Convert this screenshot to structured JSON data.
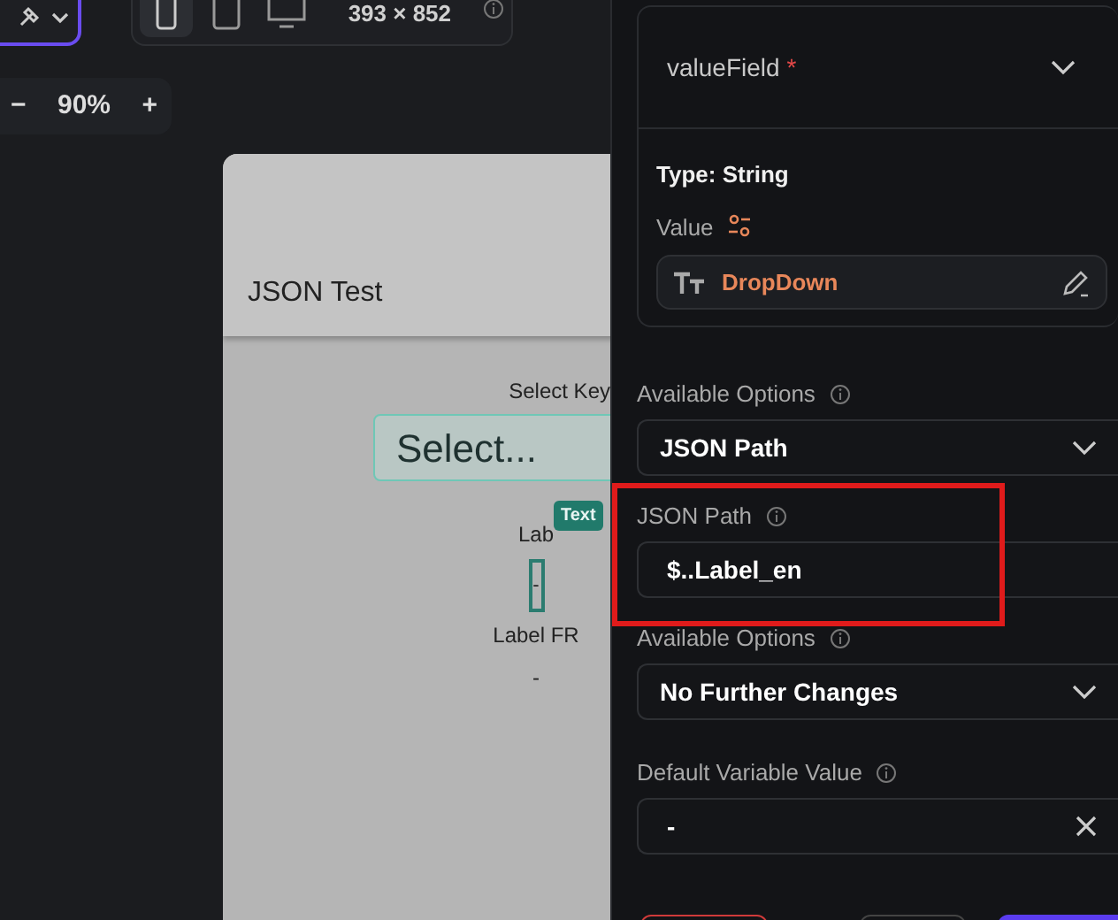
{
  "toolbar": {
    "device_options": [
      {
        "kind": "phone",
        "selected": true
      },
      {
        "kind": "tablet",
        "selected": false
      },
      {
        "kind": "desktop",
        "selected": false
      }
    ],
    "size": "393 × 852"
  },
  "zoom": {
    "minus": "−",
    "value": "90%",
    "plus": "+"
  },
  "preview": {
    "title": "JSON Test",
    "select_label": "Select Key",
    "select_placeholder": "Select...",
    "label_en": "Lab",
    "badge": "Text",
    "label_en_value": "-",
    "label_fr": "Label FR",
    "label_fr_value": "-"
  },
  "panel": {
    "field_name": "valueField",
    "required_mark": "*",
    "type": "Type: String",
    "value_label": "Value",
    "value_widget": "DropDown",
    "sections": [
      {
        "kind": "select",
        "label": "Available Options",
        "value": "JSON Path",
        "highlighted": false
      },
      {
        "kind": "input",
        "label": "JSON Path",
        "value": "$..Label_en",
        "highlighted": true
      },
      {
        "kind": "select",
        "label": "Available Options",
        "value": "No Further Changes",
        "highlighted": false
      },
      {
        "kind": "clearable",
        "label": "Default Variable Value",
        "value": "-",
        "highlighted": false
      }
    ]
  }
}
